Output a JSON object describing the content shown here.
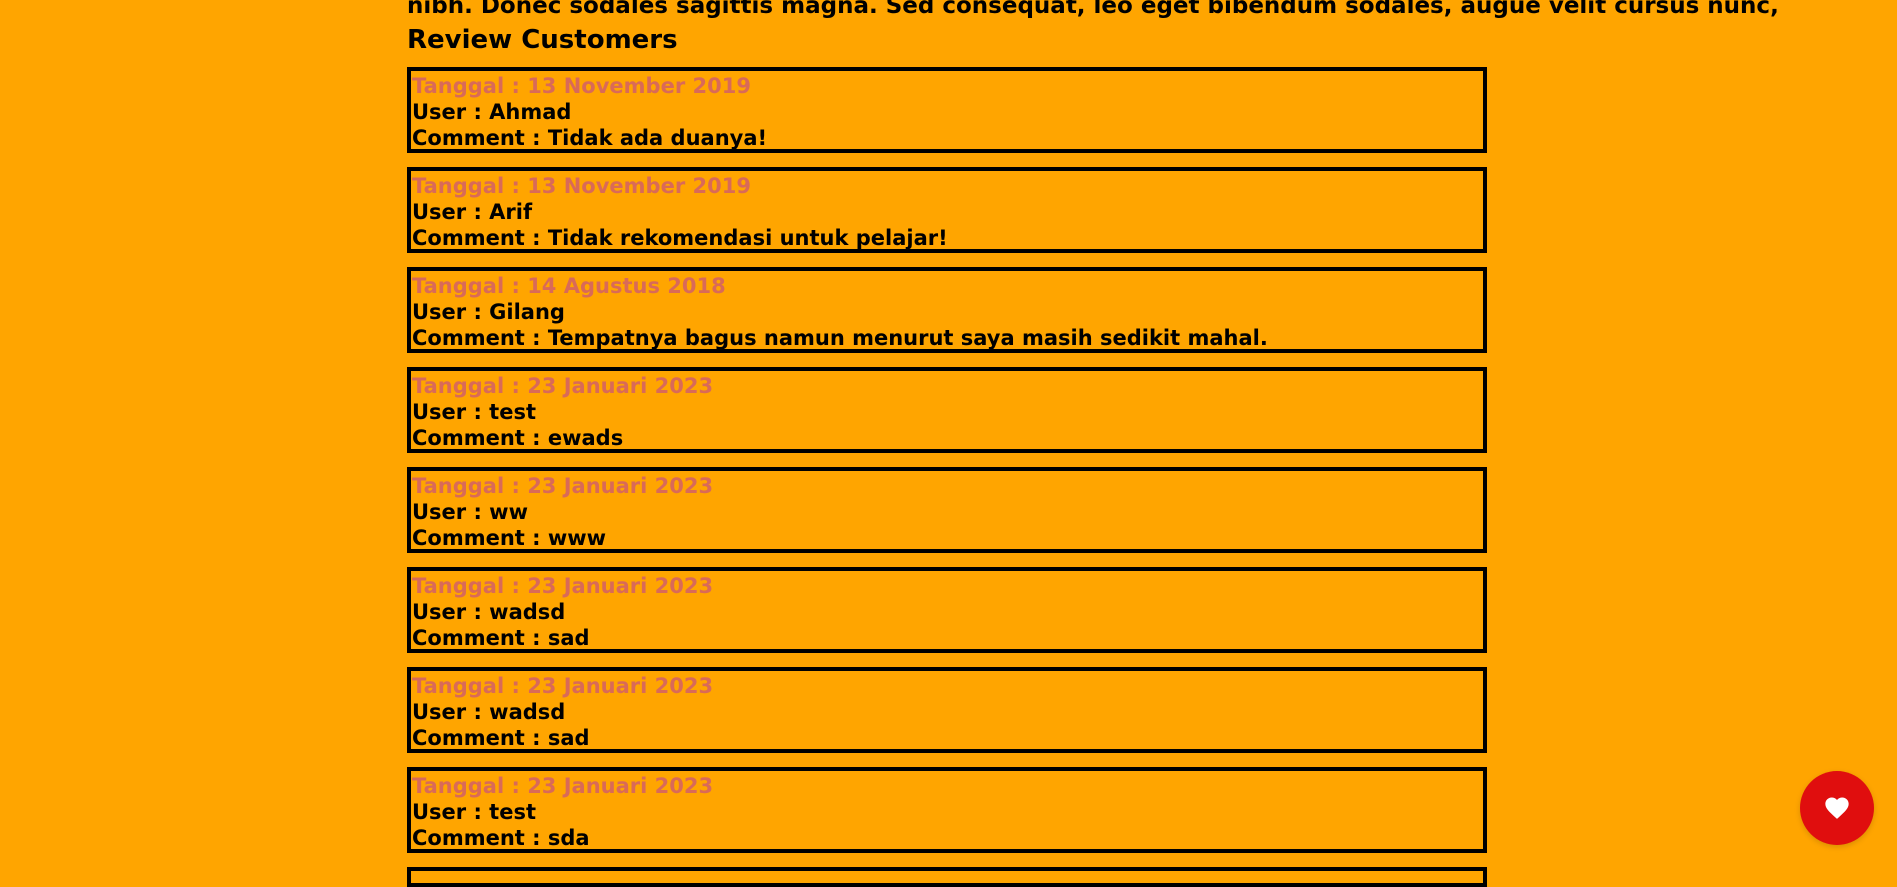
{
  "page": {
    "intro_text": "nibh. Donec sodales sagittis magna. Sed consequat, leo eget bibendum sodales, augue velit cursus nunc,",
    "reviews_title": "Review Customers"
  },
  "reviews": [
    {
      "date": "Tanggal : 13 November 2019",
      "user": "User : Ahmad",
      "comment": "Comment : Tidak ada duanya!"
    },
    {
      "date": "Tanggal : 13 November 2019",
      "user": "User : Arif",
      "comment": "Comment : Tidak rekomendasi untuk pelajar!"
    },
    {
      "date": "Tanggal : 14 Agustus 2018",
      "user": "User : Gilang",
      "comment": "Comment : Tempatnya bagus namun menurut saya masih sedikit mahal."
    },
    {
      "date": "Tanggal : 23 Januari 2023",
      "user": "User : test",
      "comment": "Comment : ewads"
    },
    {
      "date": "Tanggal : 23 Januari 2023",
      "user": "User : ww",
      "comment": "Comment : www"
    },
    {
      "date": "Tanggal : 23 Januari 2023",
      "user": "User : wadsd",
      "comment": "Comment : sad"
    },
    {
      "date": "Tanggal : 23 Januari 2023",
      "user": "User : wadsd",
      "comment": "Comment : sad"
    },
    {
      "date": "Tanggal : 23 Januari 2023",
      "user": "User : test",
      "comment": "Comment : sda"
    }
  ],
  "floating_button": {
    "icon": "heart-icon"
  },
  "colors": {
    "background": "#FFA500",
    "date_text": "#D96A58",
    "floating_button": "#E00E0E"
  }
}
